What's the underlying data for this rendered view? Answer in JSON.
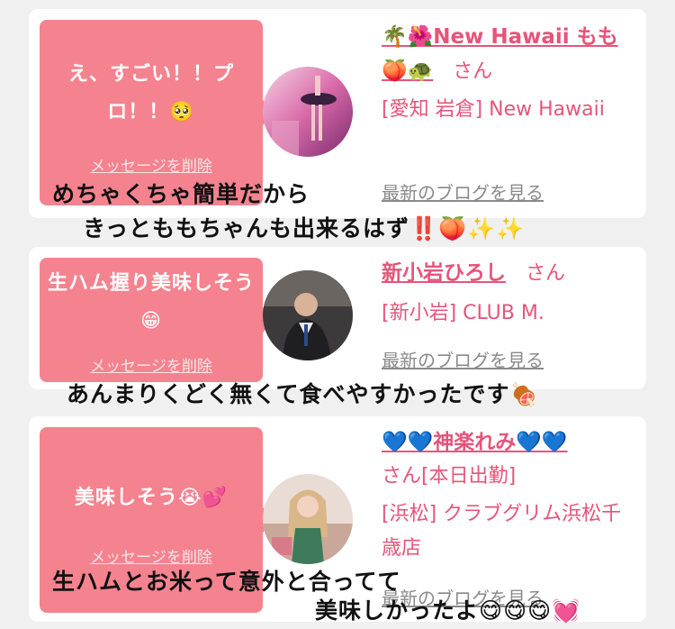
{
  "cards": [
    {
      "message": "え、すごい！！プロ！！🥺",
      "delete_label": "メッセージを削除",
      "name": "🌴🌺New Hawaii もも🍑🐢",
      "honorific": "さん",
      "location": "[愛知 岩倉] New Hawaii",
      "blog_link": "最新のブログを見る"
    },
    {
      "message": "生ハム握り美味しそう😁",
      "delete_label": "メッセージを削除",
      "name": "新小岩ひろし",
      "honorific": "さん",
      "location": "[新小岩] CLUB M.",
      "blog_link": "最新のブログを見る"
    },
    {
      "message": "美味しそう😭💕",
      "delete_label": "メッセージを削除",
      "name": "💙💙神楽れみ💙💙",
      "honorific": "さん[本日出勤]",
      "location": "[浜松] クラブグリム浜松千歳店",
      "blog_link": "最新のブログを見る"
    }
  ],
  "captions": {
    "c1_line1": "めちゃくちゃ簡単だから",
    "c1_line2": "きっとももちゃんも出来るはず‼️🍑✨✨",
    "c2": "あんまりくどく無くて食べやすかったです🍖",
    "c3_line1": "生ハムとお米って意外と合ってて",
    "c3_line2": "美味しかったよ😋😋😋💓"
  },
  "colors": {
    "background": "#f0f0f0",
    "card": "#ffffff",
    "bubble": "#f4838f",
    "accent_text": "#e5557a",
    "link_gray": "#8a8a8a"
  }
}
